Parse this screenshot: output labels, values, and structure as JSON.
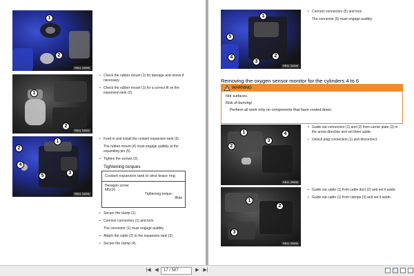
{
  "left_page": {
    "photo1": {
      "caption": "RB11 33590",
      "callouts": [
        "1",
        "2"
      ]
    },
    "photo2": {
      "caption": "RB11 33591",
      "callouts": [
        "1",
        "2"
      ]
    },
    "photo3": {
      "caption": "RB11 33495",
      "callouts": [
        "1",
        "2",
        "3",
        "4",
        "5"
      ]
    },
    "step1": [
      "Check the rubber mount (1) for damage and renew if necessary.",
      "Check the rubber mount (1) for a correct fit on the expansion tank (2)."
    ],
    "step2": [
      "Feed in and install the coolant expansion tank (3).",
      "The rubber mount (4) must engage audibly at the expanding pin (5).",
      "Tighten the screws (2)."
    ],
    "torque": {
      "title": "Tightening torques",
      "table_title": "Coolant expansion tank to strut brace ring",
      "item": "Hexagon screw",
      "size": "M6x16",
      "label": "Tightening torque:",
      "value": "8Nm"
    },
    "step3": [
      "Secure the clamp (1).",
      "Connect connectors (1) and lock.",
      "The connector (1) must engage audibly.",
      "Attach the cable (2) to the expansion tank (3).",
      "Secure the clamp (4)."
    ]
  },
  "right_page": {
    "photo4": {
      "caption": "RB11 33498",
      "callouts": [
        "1",
        "2",
        "3",
        "4",
        "5"
      ]
    },
    "step4": [
      "Connect connectors (5) and lock.",
      "The connector (5) must engage audibly."
    ],
    "section_title": "Removing the oxygen sensor monitor for the cylinders 4 to 6",
    "warning": {
      "label": "WARNING",
      "line1": "Hot surfaces.",
      "line2": "Risk of burning!",
      "bullet": "Perform all work only on components that have cooled down."
    },
    "photo5": {
      "caption": "RB11 33535",
      "callouts": [
        "1",
        "2",
        "3",
        "4"
      ]
    },
    "step5": [
      "Guide out connectors (1) and (2) from carrier plate (3) in the arrow direction and set them aside.",
      "Unlock plug connection (1) and disconnect."
    ],
    "photo6": {
      "caption": "RB11 33536",
      "callouts": [
        "1",
        "2",
        "3"
      ]
    },
    "step6": [
      "Guide out cable (1) from cable duct (2) and set it aside.",
      "Guide out cable (1) from clamps (3) and set it aside."
    ]
  },
  "toolbar": {
    "first": "|◀",
    "prev": "◀",
    "page_value": "17 / 587",
    "next": "▶",
    "last": "▶|",
    "accent": "#ef8b2c"
  }
}
